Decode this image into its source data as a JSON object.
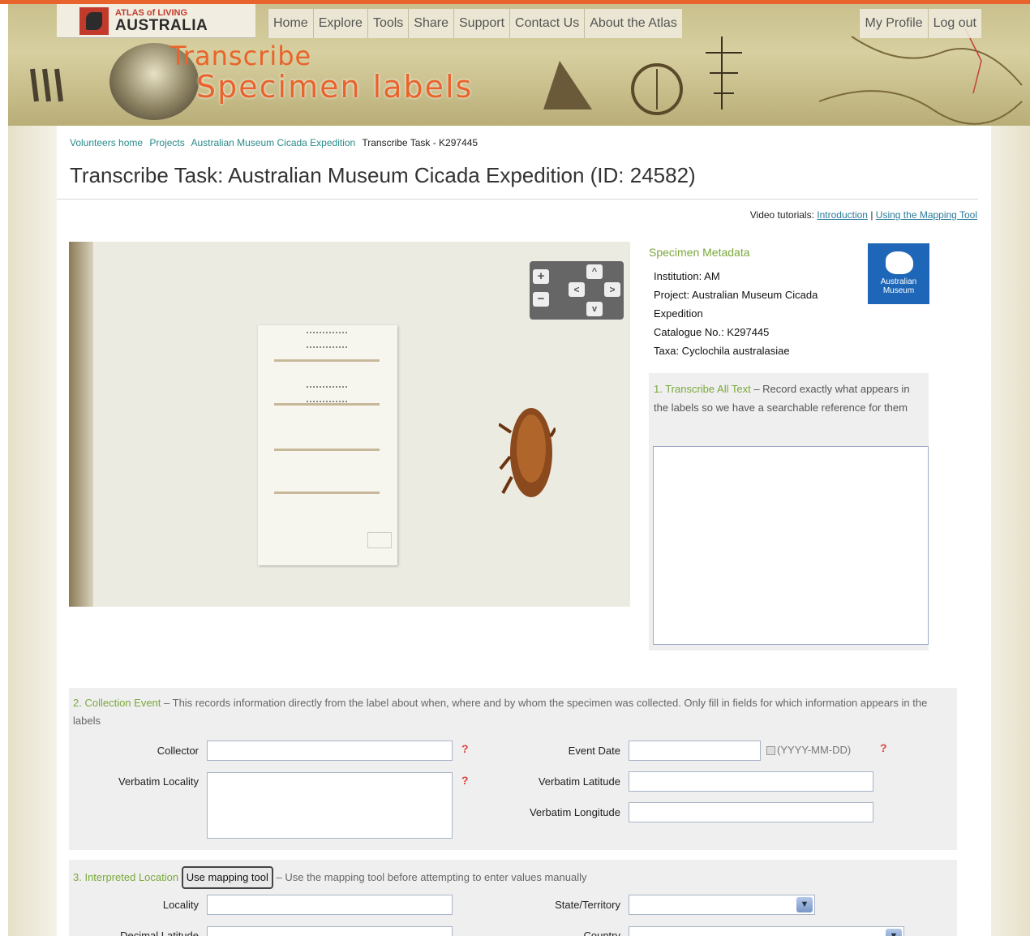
{
  "header": {
    "logo_top": "ATLAS of LIVING",
    "logo_main": "AUSTRALIA",
    "nav": [
      "Home",
      "Explore",
      "Tools",
      "Share",
      "Support",
      "Contact Us",
      "About the Atlas"
    ],
    "nav_right": [
      "My Profile",
      "Log out"
    ],
    "brand_line1": "Transcribe",
    "brand_line2": "Specimen labels"
  },
  "breadcrumb": {
    "items": [
      "Volunteers home",
      "Projects",
      "Australian Museum Cicada Expedition"
    ],
    "current": "Transcribe Task - K297445"
  },
  "page_title": "Transcribe Task: Australian Museum Cicada Expedition (ID: 24582)",
  "video": {
    "label": "Video tutorials:",
    "link1": "Introduction",
    "separator": "|",
    "link2": "Using the Mapping Tool"
  },
  "image_controls": {
    "zoom_in": "+",
    "zoom_out": "−",
    "pan_up": "^",
    "pan_down": "v",
    "pan_left": "<",
    "pan_right": ">"
  },
  "metadata": {
    "heading": "Specimen Metadata",
    "institution": "Institution: AM",
    "project": "Project: Australian Museum Cicada Expedition",
    "catalogue": "Catalogue No.: K297445",
    "taxa": "Taxa: Cyclochila australasiae",
    "museum_logo_text": "Australian Museum"
  },
  "transcribe_section": {
    "heading": "1. Transcribe All Text",
    "description": " – Record exactly what appears in the labels so we have a searchable reference for them"
  },
  "collection_event": {
    "heading": "2. Collection Event",
    "description": " – This records information directly from the label about when, where and by whom the specimen was collected. Only fill in fields for which information appears in the labels",
    "collector_label": "Collector",
    "event_date_label": "Event Date",
    "date_hint": "(YYYY-MM-DD)",
    "verbatim_locality_label": "Verbatim Locality",
    "verbatim_latitude_label": "Verbatim Latitude",
    "verbatim_longitude_label": "Verbatim Longitude",
    "help_glyph": "?"
  },
  "interpreted_location": {
    "heading": "3. Interpreted Location",
    "mapping_button": "Use mapping tool",
    "description": " – Use the mapping tool before attempting to enter values manually",
    "locality_label": "Locality",
    "state_label": "State/Territory",
    "decimal_latitude_label": "Decimal Latitude",
    "country_label": "Country"
  },
  "colors": {
    "accent_orange": "#e8642c",
    "section_green": "#7aa83a",
    "link_teal": "#2a8a8a",
    "museum_blue": "#1e67b8"
  }
}
